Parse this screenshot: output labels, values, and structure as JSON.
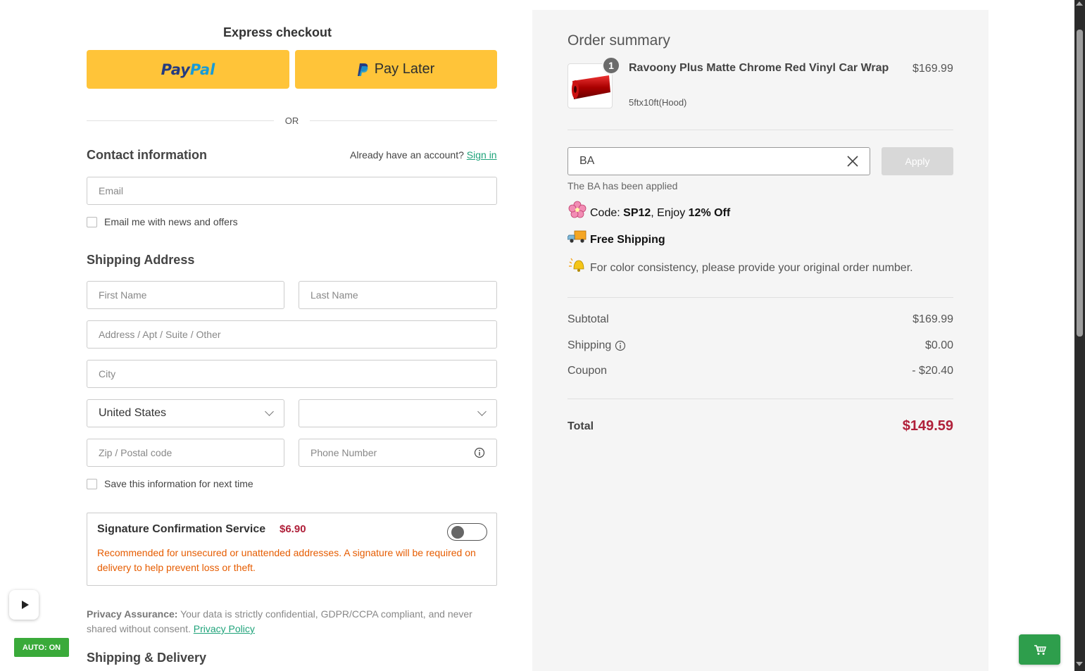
{
  "express": {
    "title": "Express checkout",
    "paypal_part1": "Pay",
    "paypal_part2": "Pal",
    "paylater_label": "Pay Later",
    "or_label": "OR"
  },
  "contact": {
    "title": "Contact information",
    "account_prompt": "Already have an account?",
    "sign_in_label": "Sign in",
    "email_placeholder": "Email",
    "newsletter_label": "Email me with news and offers"
  },
  "shipping": {
    "title": "Shipping Address",
    "first_name_placeholder": "First Name",
    "last_name_placeholder": "Last Name",
    "address_placeholder": "Address / Apt / Suite / Other",
    "city_placeholder": "City",
    "country_value": "United States",
    "state_value": "",
    "zip_placeholder": "Zip / Postal code",
    "phone_placeholder": "Phone Number",
    "save_info_label": "Save this information for next time"
  },
  "signature": {
    "title": "Signature Confirmation Service",
    "price": "$6.90",
    "description": "Recommended for unsecured or unattended addresses. A signature will be required on delivery to help prevent loss or theft.",
    "enabled": false
  },
  "privacy": {
    "label": "Privacy Assurance:",
    "text": " Your data is strictly confidential, GDPR/CCPA compliant, and never shared without consent. ",
    "link_label": "Privacy Policy"
  },
  "delivery": {
    "title": "Shipping & Delivery"
  },
  "summary": {
    "title": "Order summary",
    "item": {
      "quantity": "1",
      "name": "Ravoony Plus Matte Chrome Red Vinyl Car Wrap",
      "price": "$169.99",
      "variant": "5ftx10ft(Hood)"
    },
    "coupon": {
      "value": "BA",
      "apply_label": "Apply",
      "applied_message": "The BA has been applied"
    },
    "promos": {
      "code_prefix": "Code: ",
      "code": "SP12",
      "code_mid": ", Enjoy ",
      "code_discount": "12% Off",
      "free_shipping": "Free Shipping",
      "color_note": "For color consistency, please provide your original order number."
    },
    "subtotal_label": "Subtotal",
    "subtotal_value": "$169.99",
    "shipping_label": "Shipping",
    "shipping_value": "$0.00",
    "coupon_label": "Coupon",
    "coupon_value": "- $20.40",
    "total_label": "Total",
    "total_value": "$149.59"
  },
  "widgets": {
    "auto_label": "AUTO: ON"
  },
  "colors": {
    "paypal_yellow": "#ffc439",
    "accent_green": "#1fa37a",
    "price_red": "#b0203a",
    "warning_orange": "#e65c00"
  }
}
